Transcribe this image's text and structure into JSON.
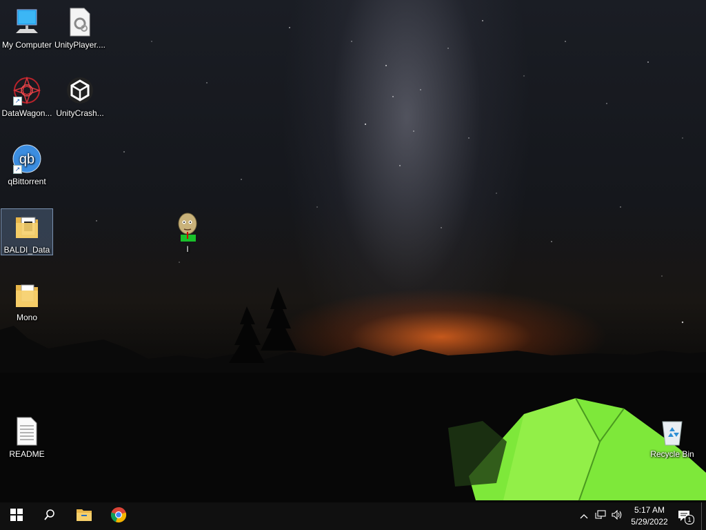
{
  "desktop": {
    "icons": [
      {
        "label": "My Computer",
        "icon": "computer-icon"
      },
      {
        "label": "UnityPlayer....",
        "icon": "dll-file-icon"
      },
      {
        "label": "DataWagon...",
        "icon": "datawagon-icon"
      },
      {
        "label": "UnityCrash...",
        "icon": "unity-icon"
      },
      {
        "label": "qBittorrent",
        "icon": "qbittorrent-icon"
      },
      {
        "label": "BALDI_Data",
        "icon": "folder-icon"
      },
      {
        "label": "I",
        "icon": "baldi-icon"
      },
      {
        "label": "Mono",
        "icon": "folder-icon"
      },
      {
        "label": "README",
        "icon": "text-document-icon"
      },
      {
        "label": "Recycle Bin",
        "icon": "recycle-bin-icon"
      }
    ],
    "selected_icon": "BALDI_Data"
  },
  "taskbar": {
    "start": "windows-start-icon",
    "search": "search-icon",
    "pinned": [
      "file-explorer-icon",
      "chrome-icon"
    ],
    "tray": {
      "icons": [
        "chevron-up-icon",
        "network-icon",
        "volume-icon"
      ],
      "time": "5:17 AM",
      "date": "5/29/2022",
      "notification_count": "1"
    }
  }
}
